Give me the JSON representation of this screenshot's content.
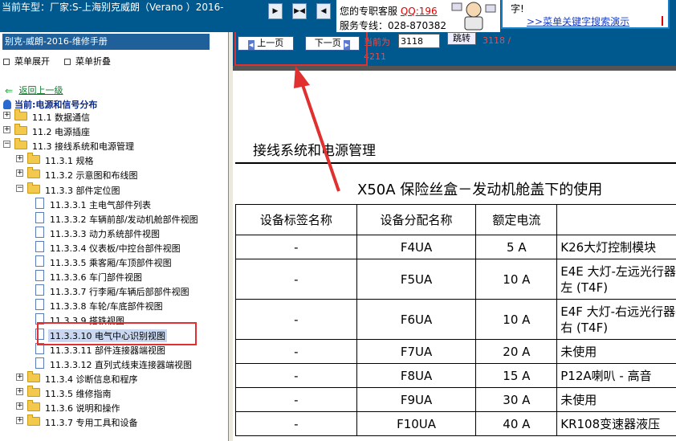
{
  "header": {
    "vehicle_text": "当前车型：厂家:S-上海别克威朗（Verano ）2016-",
    "toolbar_buttons": [
      "▶",
      "▶◀",
      "◀"
    ],
    "support_label": "您的专职客服",
    "support_qq": "QQ:196",
    "support_phone": "服务专线：028-870382",
    "help_text_1": "字!",
    "help_link": ">>菜单关键字搜索演示"
  },
  "sidebar": {
    "title": "别克-威朗-2016-维修手册",
    "expand_label": "菜单展开",
    "collapse_label": "菜单折叠",
    "back_label": "返回上一级",
    "current_label": "当前:电源和信号分布",
    "tree": [
      {
        "label": "11.1 数据通信",
        "type": "folder",
        "level": 0,
        "expanded": false
      },
      {
        "label": "11.2 电源插座",
        "type": "folder",
        "level": 0,
        "expanded": false
      },
      {
        "label": "11.3 接线系统和电源管理",
        "type": "folder",
        "level": 0,
        "expanded": true
      },
      {
        "label": "11.3.1 规格",
        "type": "folder",
        "level": 1,
        "expanded": false
      },
      {
        "label": "11.3.2 示意图和布线图",
        "type": "folder",
        "level": 1,
        "expanded": false
      },
      {
        "label": "11.3.3 部件定位图",
        "type": "folder",
        "level": 1,
        "expanded": true
      },
      {
        "label": "11.3.3.1 主电气部件列表",
        "type": "doc",
        "level": 2
      },
      {
        "label": "11.3.3.2 车辆前部/发动机舱部件视图",
        "type": "doc",
        "level": 2
      },
      {
        "label": "11.3.3.3 动力系统部件视图",
        "type": "doc",
        "level": 2
      },
      {
        "label": "11.3.3.4 仪表板/中控台部件视图",
        "type": "doc",
        "level": 2
      },
      {
        "label": "11.3.3.5 乘客厢/车顶部件视图",
        "type": "doc",
        "level": 2
      },
      {
        "label": "11.3.3.6 车门部件视图",
        "type": "doc",
        "level": 2
      },
      {
        "label": "11.3.3.7 行李厢/车辆后部部件视图",
        "type": "doc",
        "level": 2
      },
      {
        "label": "11.3.3.8 车轮/车底部件视图",
        "type": "doc",
        "level": 2
      },
      {
        "label": "11.3.3.9 搭铁视图",
        "type": "doc",
        "level": 2
      },
      {
        "label": "11.3.3.10 电气中心识别视图",
        "type": "doc",
        "level": 2,
        "selected": true
      },
      {
        "label": "11.3.3.11 部件连接器端视图",
        "type": "doc",
        "level": 2
      },
      {
        "label": "11.3.3.12 直列式线束连接器端视图",
        "type": "doc",
        "level": 2
      },
      {
        "label": "11.3.4 诊断信息和程序",
        "type": "folder",
        "level": 1,
        "expanded": false
      },
      {
        "label": "11.3.5 维修指南",
        "type": "folder",
        "level": 1,
        "expanded": false
      },
      {
        "label": "11.3.6 说明和操作",
        "type": "folder",
        "level": 1,
        "expanded": false
      },
      {
        "label": "11.3.7 专用工具和设备",
        "type": "folder",
        "level": 1,
        "expanded": false
      }
    ]
  },
  "pager": {
    "prev_label": "上一页",
    "next_label": "下一页",
    "current_prefix": "当前为",
    "current_value": "3118",
    "jump_label": "跳转",
    "page_info": "3118 /",
    "page_total": "4211"
  },
  "document": {
    "section_title": "接线系统和电源管理",
    "table_title": "X50A 保险丝盒－发动机舱盖下的使用",
    "columns": [
      "设备标签名称",
      "设备分配名称",
      "额定电流",
      ""
    ],
    "rows": [
      {
        "label": "-",
        "assignment": "F4UA",
        "rating": "5 A",
        "usage": "K26大灯控制模块"
      },
      {
        "label": "-",
        "assignment": "F5UA",
        "rating": "10 A",
        "usage": "E4E 大灯-左远光行器-左 (T4F)"
      },
      {
        "label": "-",
        "assignment": "F6UA",
        "rating": "10 A",
        "usage": "E4F 大灯-右远光行器-右 (T4F)"
      },
      {
        "label": "-",
        "assignment": "F7UA",
        "rating": "20 A",
        "usage": "未使用"
      },
      {
        "label": "-",
        "assignment": "F8UA",
        "rating": "15 A",
        "usage": "P12A喇叭 - 高音"
      },
      {
        "label": "-",
        "assignment": "F9UA",
        "rating": "30 A",
        "usage": "未使用"
      },
      {
        "label": "-",
        "assignment": "F10UA",
        "rating": "40 A",
        "usage": "KR108变速器液压"
      }
    ]
  },
  "colors": {
    "header_bg": "#00598e",
    "annotation_red": "#e03030",
    "page_info_red": "#e84b4b"
  }
}
